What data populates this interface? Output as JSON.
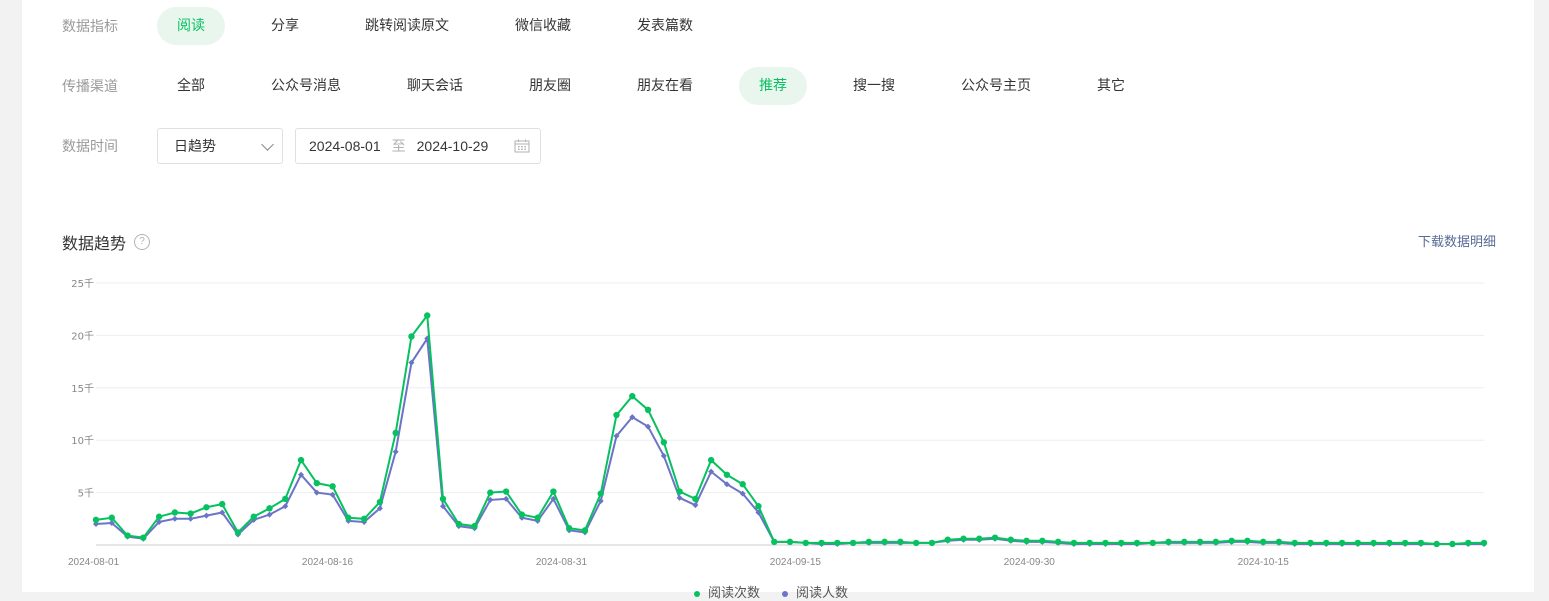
{
  "filters": {
    "metrics_label": "数据指标",
    "metrics": [
      "阅读",
      "分享",
      "跳转阅读原文",
      "微信收藏",
      "发表篇数"
    ],
    "metrics_active": 0,
    "channels_label": "传播渠道",
    "channels": [
      "全部",
      "公众号消息",
      "聊天会话",
      "朋友圈",
      "朋友在看",
      "推荐",
      "搜一搜",
      "公众号主页",
      "其它"
    ],
    "channels_active": 5,
    "time_label": "数据时间",
    "granularity": "日趋势",
    "date_start": "2024-08-01",
    "date_sep": "至",
    "date_end": "2024-10-29"
  },
  "section": {
    "title": "数据趋势",
    "help_icon": "question-circle-icon",
    "download_label": "下载数据明细"
  },
  "colors": {
    "accent": "#07c160",
    "series_2": "#6b74c6",
    "link": "#576b95"
  },
  "chart_data": {
    "type": "line",
    "x_start": "2024-08-01",
    "x_end": "2024-10-29",
    "x_ticks": [
      "2024-08-01",
      "2024-08-16",
      "2024-08-31",
      "2024-09-15",
      "2024-09-30",
      "2024-10-15"
    ],
    "y_ticks": [
      "5千",
      "10千",
      "15千",
      "20千",
      "25千"
    ],
    "ylim": [
      0,
      25000
    ],
    "grid": true,
    "legend_position": "bottom",
    "series": [
      {
        "name": "阅读次数",
        "color": "#07c160",
        "marker": "circle",
        "values": [
          2400,
          2600,
          900,
          700,
          2700,
          3100,
          3000,
          3600,
          3900,
          1200,
          2700,
          3500,
          4400,
          8100,
          5900,
          5600,
          2600,
          2500,
          4100,
          10700,
          19900,
          21900,
          4400,
          2000,
          1800,
          5000,
          5100,
          2900,
          2600,
          5100,
          1600,
          1400,
          4900,
          12400,
          14200,
          12900,
          9800,
          5100,
          4400,
          8100,
          6700,
          5800,
          3700,
          300,
          300,
          200,
          200,
          200,
          200,
          300,
          300,
          300,
          200,
          200,
          500,
          600,
          600,
          700,
          500,
          400,
          400,
          300,
          200,
          200,
          200,
          200,
          200,
          200,
          300,
          300,
          300,
          300,
          400,
          400,
          300,
          300,
          200,
          200,
          200,
          200,
          200,
          200,
          200,
          200,
          200,
          100,
          100,
          200,
          200
        ]
      },
      {
        "name": "阅读人数",
        "color": "#6b74c6",
        "marker": "diamond",
        "values": [
          2000,
          2100,
          800,
          600,
          2200,
          2500,
          2500,
          2800,
          3100,
          1000,
          2400,
          2900,
          3700,
          6700,
          5000,
          4800,
          2300,
          2200,
          3500,
          8900,
          17400,
          19700,
          3700,
          1800,
          1600,
          4300,
          4400,
          2600,
          2300,
          4400,
          1400,
          1200,
          4200,
          10400,
          12200,
          11300,
          8500,
          4500,
          3800,
          7000,
          5800,
          4900,
          3100,
          300,
          300,
          200,
          100,
          100,
          200,
          200,
          200,
          200,
          200,
          200,
          400,
          500,
          500,
          600,
          400,
          300,
          300,
          200,
          100,
          100,
          100,
          100,
          100,
          200,
          200,
          200,
          200,
          200,
          300,
          300,
          200,
          200,
          100,
          100,
          100,
          100,
          100,
          100,
          100,
          100,
          100,
          100,
          100,
          100,
          100
        ]
      }
    ]
  }
}
